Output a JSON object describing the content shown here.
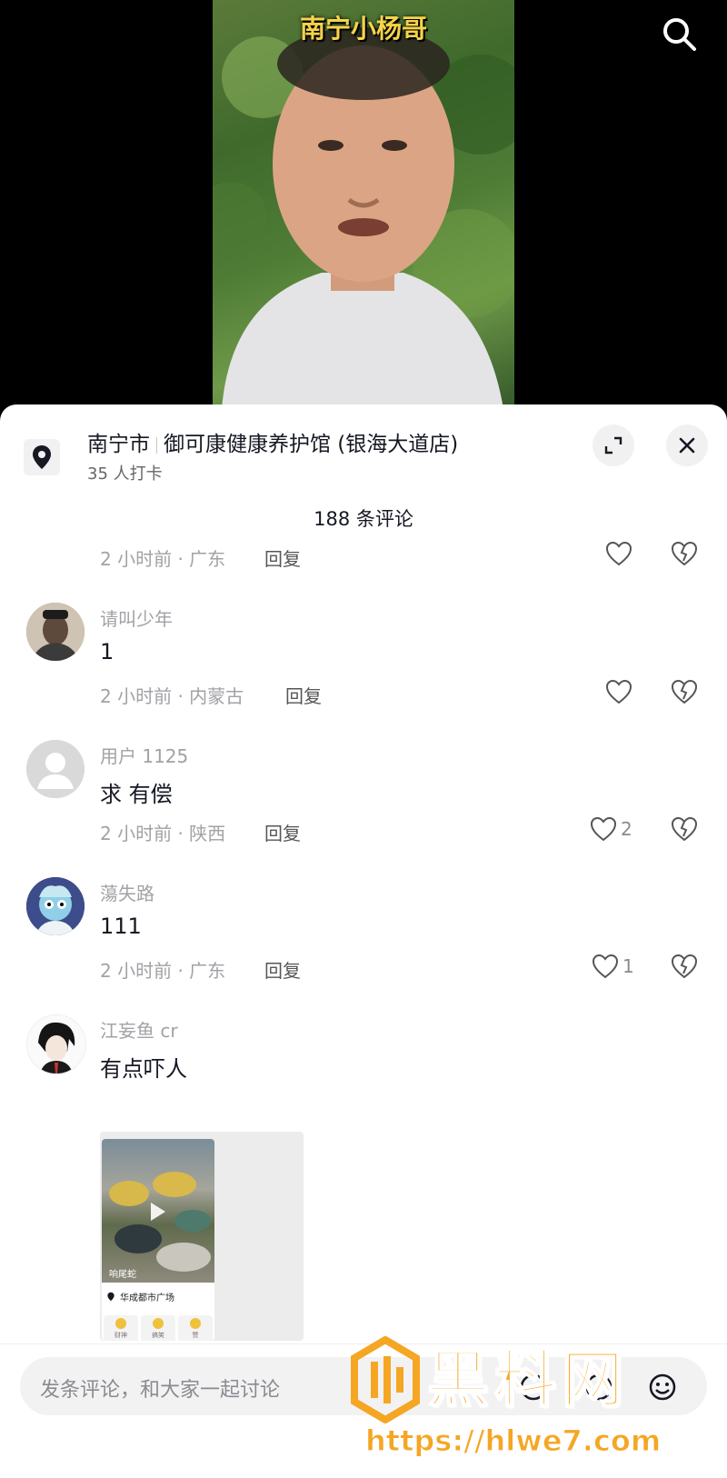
{
  "video": {
    "overlay_title": "南宁小杨哥"
  },
  "location": {
    "city": "南宁市",
    "name": "御可康健康养护馆 (银海大道店)",
    "checkins": "35 人打卡"
  },
  "comments_header": {
    "count_label": "188 条评论"
  },
  "comments": [
    {
      "meta": "2 小时前 · 广东",
      "reply": "回复",
      "likes": ""
    },
    {
      "user": "请叫少年",
      "text": "1",
      "meta": "2 小时前 · 内蒙古",
      "reply": "回复",
      "likes": ""
    },
    {
      "user": "用户 1125",
      "text": "求 有偿",
      "meta": "2 小时前 · 陕西",
      "reply": "回复",
      "likes": "2"
    },
    {
      "user": "蕩失路",
      "text": "111",
      "meta": "2 小时前 · 广东",
      "reply": "回复",
      "likes": "1"
    },
    {
      "user": "江妄鱼 cr",
      "text": "有点吓人"
    }
  ],
  "attached_image": {
    "tag": "响尾蛇",
    "location": "华成都市广场",
    "emotes": [
      "财神",
      "搞笑",
      "赞"
    ]
  },
  "input": {
    "placeholder": "发条评论，和大家一起讨论"
  },
  "watermark": {
    "text": "黑料网",
    "url": "https://hlwe7.com"
  },
  "colors": {
    "accent_text": "#161823",
    "meta_gray": "#a1a2a6",
    "watermark_orange": "#f5a623",
    "video_title_yellow": "#f6d34a"
  }
}
